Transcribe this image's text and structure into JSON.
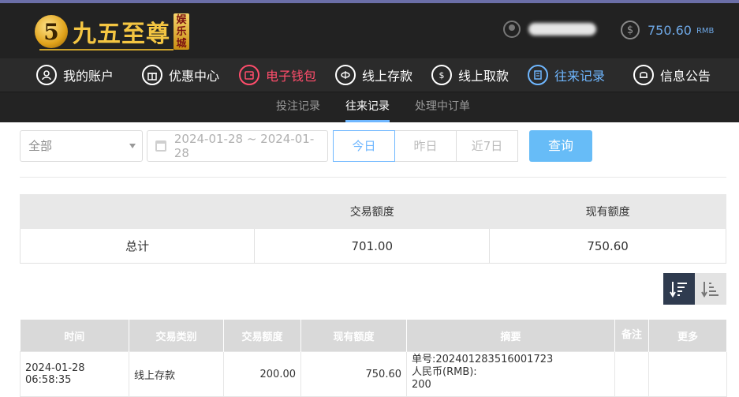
{
  "header": {
    "logo_mark": "5",
    "logo_text": "九五至尊",
    "logo_sub": "娱乐城",
    "balance_amount": "750.60",
    "balance_unit": "RMB"
  },
  "nav": {
    "items": [
      {
        "label": "我的账户",
        "icon": "user-icon"
      },
      {
        "label": "优惠中心",
        "icon": "gift-icon"
      },
      {
        "label": "电子钱包",
        "icon": "wallet-icon"
      },
      {
        "label": "线上存款",
        "icon": "deposit-icon"
      },
      {
        "label": "线上取款",
        "icon": "withdraw-icon"
      },
      {
        "label": "往来记录",
        "icon": "records-icon"
      },
      {
        "label": "信息公告",
        "icon": "bell-icon"
      }
    ]
  },
  "subnav": {
    "tabs": [
      {
        "label": "投注记录"
      },
      {
        "label": "往来记录"
      },
      {
        "label": "处理中订单"
      }
    ]
  },
  "filters": {
    "type_select": "全部",
    "date_range": "2024-01-28 ~ 2024-01-28",
    "quick": [
      "今日",
      "昨日",
      "近7日"
    ],
    "query_label": "查询"
  },
  "summary": {
    "headers": [
      "",
      "交易额度",
      "现有额度"
    ],
    "row": {
      "label": "总计",
      "transaction": "701.00",
      "current": "750.60"
    }
  },
  "records": {
    "headers": [
      "时间",
      "交易类别",
      "交易额度",
      "现有额度",
      "摘要",
      "备注",
      "更多"
    ],
    "rows": [
      {
        "time": "2024-01-28 06:58:35",
        "type": "线上存款",
        "amount": "200.00",
        "balance": "750.60",
        "summary_line1": "单号:202401283516001723",
        "summary_line2": "人民币(RMB):",
        "summary_line3": "200",
        "note": "",
        "more": ""
      }
    ]
  },
  "colors": {
    "accent_blue": "#6fb7ff",
    "active_red": "#ff4d6b",
    "header_bg": "#222222",
    "query_button": "#67bcf7"
  }
}
